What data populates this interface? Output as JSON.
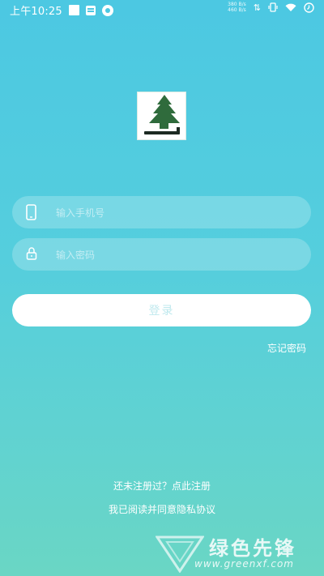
{
  "status_bar": {
    "time": "上午10:25",
    "net_speed_up": "380 B/s",
    "net_speed_down": "460 B/s"
  },
  "login": {
    "phone_placeholder": "输入手机号",
    "password_placeholder": "输入密码",
    "login_button": "登录",
    "forgot_password": "忘记密码",
    "register_prompt": "还未注册过？点此注册",
    "privacy_agreement": "我已阅读并同意隐私协议"
  },
  "watermark": {
    "title": "绿色先锋",
    "url": "www.greenxf.com"
  },
  "colors": {
    "background_top": "#4cc8e2",
    "background_bottom": "#6ad6c4",
    "logo_tree": "#2f6b3c"
  },
  "icons": {
    "phone": "phone-icon",
    "lock": "lock-icon",
    "logo": "pine-tree-logo"
  }
}
